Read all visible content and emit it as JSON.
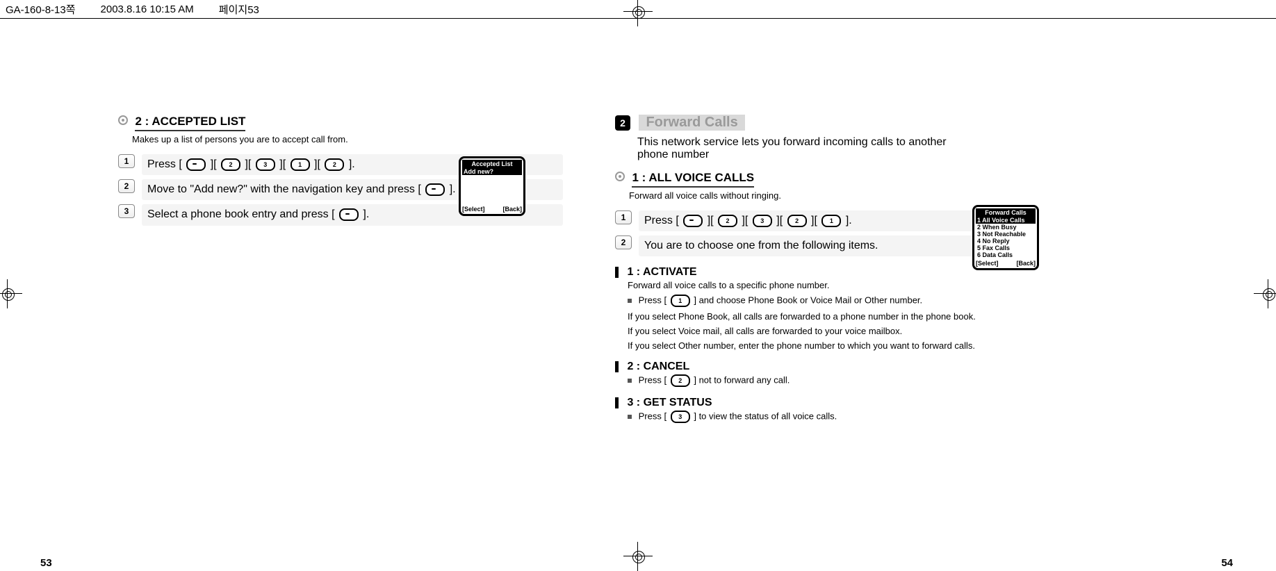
{
  "docbar": {
    "file": "GA-160-8-13쪽",
    "timestamp": "2003.8.16 10:15 AM",
    "page_label": "페이지53"
  },
  "page_numbers": {
    "left": "53",
    "right": "54"
  },
  "left": {
    "heading": "2 : ACCEPTED LIST",
    "sub": "Makes up a list of persons you are to accept call from.",
    "steps": [
      {
        "n": "1",
        "pre": "Press [",
        "keys": [
          "soft",
          "2",
          "3",
          "1",
          "2"
        ],
        "post": "]."
      },
      {
        "n": "2",
        "pre": "Move to \"Add new?\" with the navigation key and press [",
        "keys": [
          "soft"
        ],
        "post": "]."
      },
      {
        "n": "3",
        "pre": "Select a phone book entry and press [",
        "keys": [
          "soft"
        ],
        "post": "]."
      }
    ],
    "phone": {
      "title": "Accepted List",
      "rows": [
        {
          "t": "Add new?",
          "inv": true
        }
      ],
      "soft_left": "[Select]",
      "soft_right": "[Back]"
    }
  },
  "right": {
    "sec_num": "2",
    "sec_title": "Forward Calls",
    "lead": "This network service lets you forward incoming calls to another phone number",
    "sub_heading": "1 : ALL VOICE CALLS",
    "sub_desc": "Forward all voice calls without ringing.",
    "steps": [
      {
        "n": "1",
        "pre": "Press [",
        "keys": [
          "soft",
          "2",
          "3",
          "2",
          "1"
        ],
        "post": "]."
      },
      {
        "n": "2",
        "pre": "You are to choose one from the following items.",
        "keys": [],
        "post": ""
      }
    ],
    "phone": {
      "title": "Forward Calls",
      "rows": [
        {
          "t": "1 All Voice Calls",
          "inv": true
        },
        {
          "t": "2 When Busy",
          "inv": false
        },
        {
          "t": "3 Not Reachable",
          "inv": false
        },
        {
          "t": "4 No Reply",
          "inv": false
        },
        {
          "t": "5 Fax Calls",
          "inv": false
        },
        {
          "t": "6 Data Calls",
          "inv": false
        }
      ],
      "soft_left": "[Select]",
      "soft_right": "[Back]"
    },
    "items": {
      "activate": {
        "title": "1 : ACTIVATE",
        "desc": "Forward all voice calls to a specific phone number.",
        "bullet_pre": "Press [",
        "bullet_key": "1",
        "bullet_post": "] and choose Phone Book or Voice Mail or Other number.",
        "note1": "If you select Phone Book, all calls are forwarded to a phone number in the phone book.",
        "note2": "If you select Voice mail, all calls are forwarded to your voice mailbox.",
        "note3": "If you select Other number, enter the phone number to which you want to forward calls."
      },
      "cancel": {
        "title": "2 : CANCEL",
        "bullet_pre": "Press [",
        "bullet_key": "2",
        "bullet_post": "] not to forward any call."
      },
      "status": {
        "title": "3 : GET STATUS",
        "bullet_pre": "Press [",
        "bullet_key": "3",
        "bullet_post": "] to view the status of all voice calls."
      }
    }
  }
}
